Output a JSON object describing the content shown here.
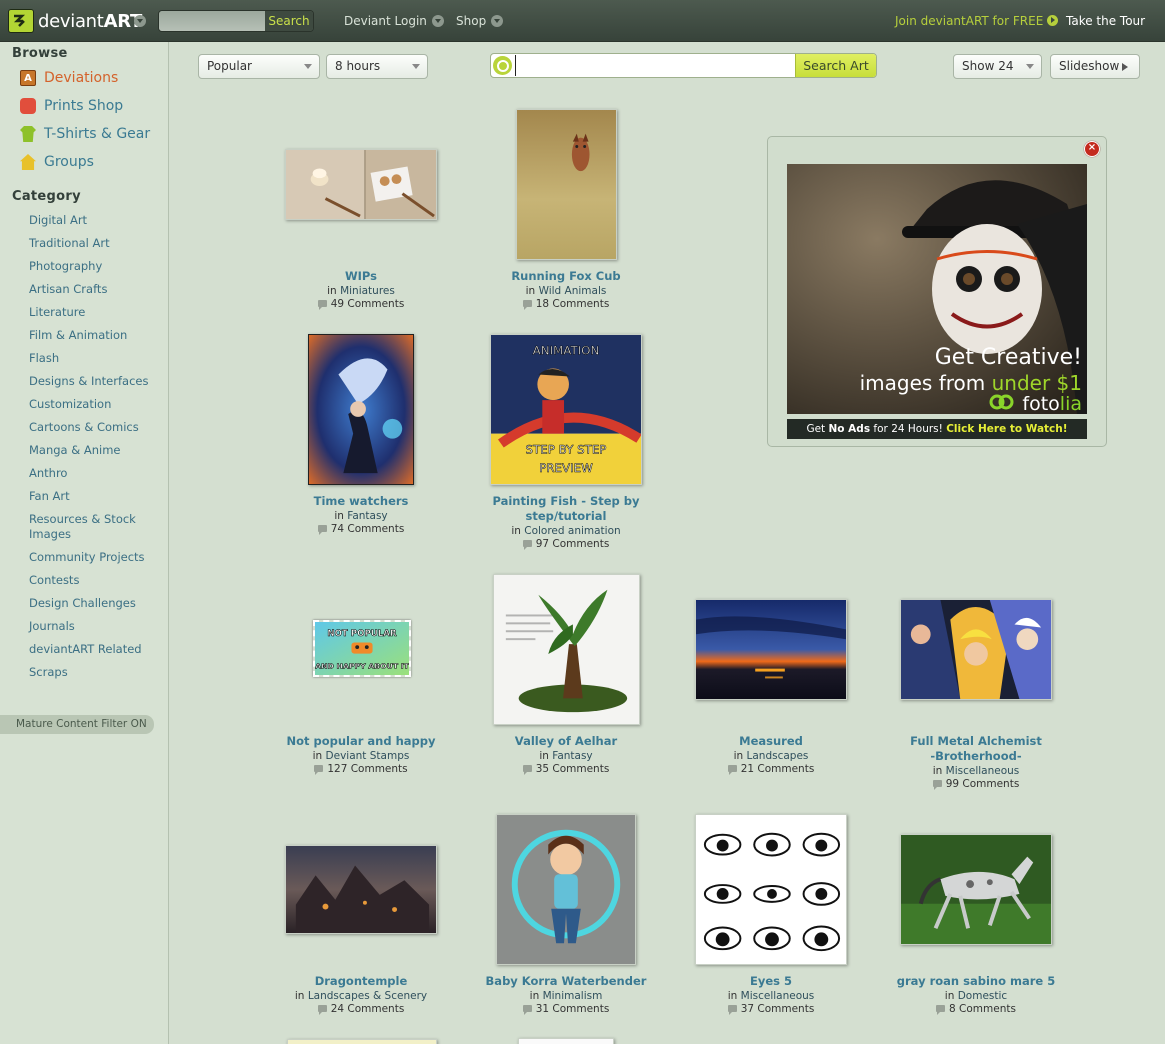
{
  "topbar": {
    "logo_text_a": "deviant",
    "logo_text_b": "ART",
    "search_button": "Search",
    "links": [
      "Deviant Login",
      "Shop"
    ],
    "join": "Join deviantART for FREE",
    "tour": "Take the Tour"
  },
  "sidebar": {
    "browse_title": "Browse",
    "browse_items": [
      {
        "label": "Deviations",
        "icon": "deviations-icon",
        "active": true
      },
      {
        "label": "Prints Shop",
        "icon": "prints-icon"
      },
      {
        "label": "T-Shirts & Gear",
        "icon": "tshirt-icon"
      },
      {
        "label": "Groups",
        "icon": "groups-icon"
      }
    ],
    "category_title": "Category",
    "categories": [
      "Digital Art",
      "Traditional Art",
      "Photography",
      "Artisan Crafts",
      "Literature",
      "Film & Animation",
      "Flash",
      "Designs & Interfaces",
      "Customization",
      "Cartoons & Comics",
      "Manga & Anime",
      "Anthro",
      "Fan Art",
      "Resources & Stock Images",
      "Community Projects",
      "Contests",
      "Design Challenges",
      "Journals",
      "deviantART Related",
      "Scraps"
    ],
    "mature_filter": "Mature Content Filter ON"
  },
  "filters": {
    "sort": "Popular",
    "time": "8 hours",
    "search_value": "",
    "search_button": "Search Art",
    "show": "Show 24",
    "slideshow": "Slideshow"
  },
  "deviations": [
    {
      "title": "WIPs",
      "category": "Miniatures",
      "comments": "49 Comments"
    },
    {
      "title": "Running Fox Cub",
      "category": "Wild Animals",
      "comments": "18 Comments"
    },
    {
      "title": "Time watchers",
      "category": "Fantasy",
      "comments": "74 Comments"
    },
    {
      "title": "Painting Fish - Step by step/tutorial",
      "category": "Colored animation",
      "comments": "97 Comments"
    },
    {
      "title": "Not popular and happy",
      "category": "Deviant Stamps",
      "comments": "127 Comments"
    },
    {
      "title": "Valley of Aelhar",
      "category": "Fantasy",
      "comments": "35 Comments"
    },
    {
      "title": "Measured",
      "category": "Landscapes",
      "comments": "21 Comments"
    },
    {
      "title": "Full Metal Alchemist -Brotherhood-",
      "category": "Miscellaneous",
      "comments": "99 Comments"
    },
    {
      "title": "Dragontemple",
      "category": "Landscapes & Scenery",
      "comments": "24 Comments"
    },
    {
      "title": "Baby Korra Waterbender",
      "category": "Minimalism",
      "comments": "31 Comments"
    },
    {
      "title": "Eyes 5",
      "category": "Miscellaneous",
      "comments": "37 Comments"
    },
    {
      "title": "gray roan sabino mare 5",
      "category": "Domestic",
      "comments": "8 Comments"
    }
  ],
  "in_label": "in",
  "thumb_text": {
    "animation": "ANIMATION",
    "step": "STEP BY STEP",
    "preview": "PREVIEW",
    "stamp_top": "NOT POPULAR",
    "stamp_bottom": "AND HAPPY ABOUT IT"
  },
  "ad": {
    "headline": "Get Creative!",
    "line2_a": "images from",
    "line2_b": "under $1",
    "brand_a": "foto",
    "brand_b": "lia",
    "bar_a": "Get",
    "bar_b": "No Ads",
    "bar_c": "for 24 Hours!",
    "bar_link": "Click Here to Watch!"
  }
}
